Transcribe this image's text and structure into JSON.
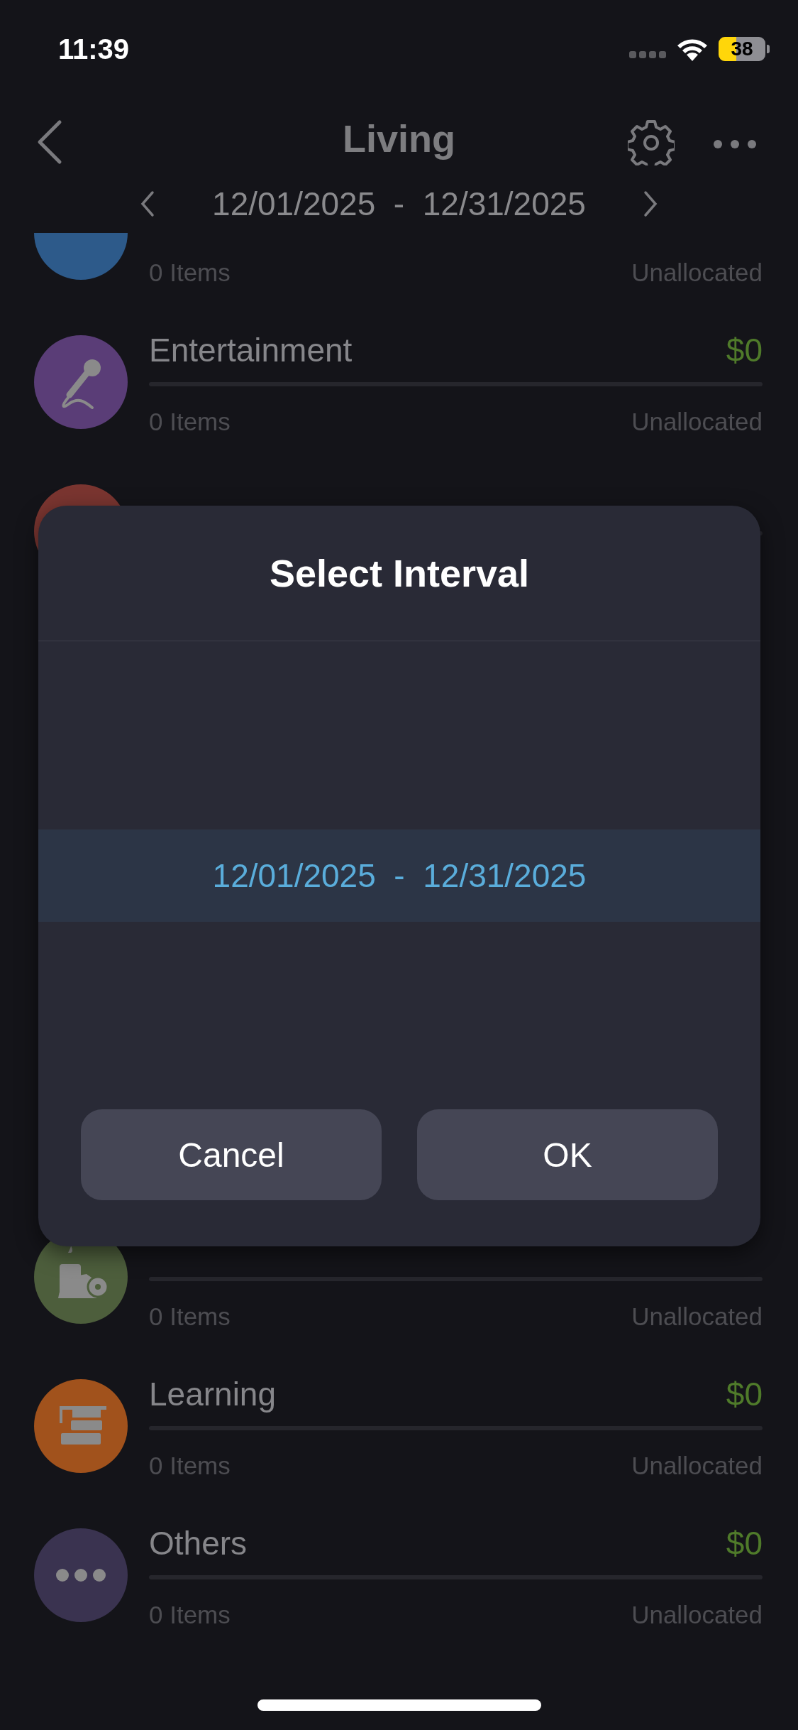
{
  "status_bar": {
    "time": "11:39",
    "battery": "38"
  },
  "nav": {
    "title": "Living",
    "date_range": {
      "start": "12/01/2025",
      "separator": "-",
      "end": "12/31/2025"
    }
  },
  "categories": [
    {
      "items": "0 Items",
      "status": "Unallocated",
      "color": "#2d5a8a"
    },
    {
      "name": "Entertainment",
      "amount": "$0",
      "items": "0 Items",
      "status": "Unallocated",
      "color": "#5a3d77"
    },
    {
      "color": "#7a3530"
    },
    {
      "items": "0 Items",
      "status": "Unallocated",
      "color": "#4d5e3c"
    },
    {
      "name": "Learning",
      "amount": "$0",
      "items": "0 Items",
      "status": "Unallocated",
      "color": "#a1521c"
    },
    {
      "name": "Others",
      "amount": "$0",
      "items": "0 Items",
      "status": "Unallocated",
      "color": "#3a3350"
    }
  ],
  "dialog": {
    "title": "Select Interval",
    "options": [
      {
        "start": "12/01/2025",
        "separator": "-",
        "end": "12/31/2025",
        "selected": true
      }
    ],
    "buttons": [
      "Cancel",
      "OK"
    ]
  }
}
